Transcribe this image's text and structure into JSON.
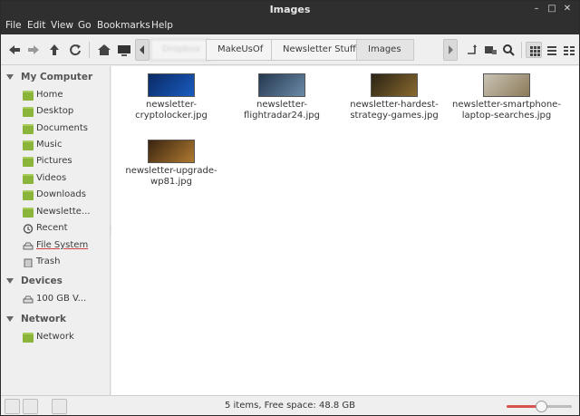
{
  "window": {
    "title": "Images"
  },
  "menu": [
    "File",
    "Edit",
    "View",
    "Go",
    "Bookmarks",
    "Help"
  ],
  "breadcrumbs": [
    "Dropbox",
    "MakeUsOf",
    "Newsletter Stuff",
    "Images"
  ],
  "sidebar": {
    "my_computer": {
      "header": "My Computer",
      "items": [
        {
          "label": "Home",
          "icon": "home-folder-icon"
        },
        {
          "label": "Desktop",
          "icon": "desktop-folder-icon"
        },
        {
          "label": "Documents",
          "icon": "documents-folder-icon"
        },
        {
          "label": "Music",
          "icon": "music-folder-icon"
        },
        {
          "label": "Pictures",
          "icon": "pictures-folder-icon"
        },
        {
          "label": "Videos",
          "icon": "videos-folder-icon"
        },
        {
          "label": "Downloads",
          "icon": "downloads-folder-icon"
        },
        {
          "label": "Newslette...",
          "icon": "folder-icon"
        },
        {
          "label": "Recent",
          "icon": "recent-icon"
        },
        {
          "label": "File System",
          "icon": "drive-icon"
        },
        {
          "label": "Trash",
          "icon": "trash-icon"
        }
      ]
    },
    "devices": {
      "header": "Devices",
      "items": [
        {
          "label": "100 GB V...",
          "icon": "drive-icon"
        }
      ]
    },
    "network": {
      "header": "Network",
      "items": [
        {
          "label": "Network",
          "icon": "network-icon"
        }
      ]
    }
  },
  "files": [
    {
      "name": "newsletter-cryptolocker.jpg",
      "colors": [
        "#0a2a66",
        "#1a5cc0"
      ]
    },
    {
      "name": "newsletter-flightradar24.jpg",
      "colors": [
        "#24384f",
        "#6b8aa8"
      ]
    },
    {
      "name": "newsletter-hardest-strategy-games.jpg",
      "colors": [
        "#2a2315",
        "#8a6a2e"
      ]
    },
    {
      "name": "newsletter-smartphone-laptop-searches.jpg",
      "colors": [
        "#c9c4b5",
        "#8c7a5a"
      ]
    },
    {
      "name": "newsletter-upgrade-wp81.jpg",
      "colors": [
        "#3a2410",
        "#b07a30"
      ]
    }
  ],
  "status": {
    "text": "5 items, Free space: 48.8 GB",
    "zoom_level": 0.53
  }
}
